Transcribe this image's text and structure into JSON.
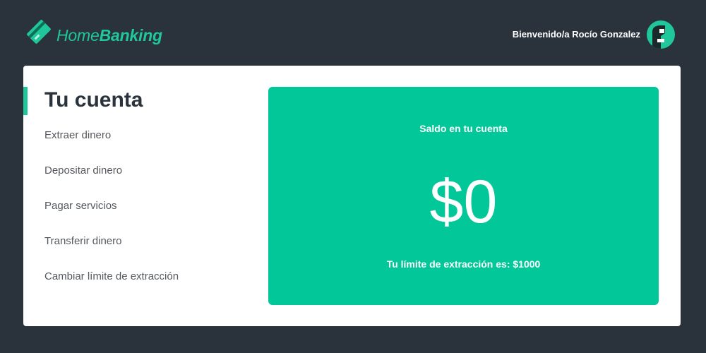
{
  "header": {
    "brand_light": "Home",
    "brand_bold": "Banking",
    "welcome": "Bienvenido/a Rocío Gonzalez"
  },
  "account": {
    "title": "Tu cuenta",
    "menu": [
      {
        "label": "Extraer dinero"
      },
      {
        "label": "Depositar dinero"
      },
      {
        "label": "Pagar servicios"
      },
      {
        "label": "Transferir dinero"
      },
      {
        "label": "Cambiar límite de extracción"
      }
    ]
  },
  "balance": {
    "label": "Saldo en tu cuenta",
    "amount": "$0",
    "limit_text": "Tu límite de extracción es: $1000"
  },
  "colors": {
    "background": "#2a323c",
    "accent": "#1fc79a",
    "panel": "#02c798",
    "card": "#ffffff"
  },
  "icons": {
    "logo": "card-logo-icon",
    "avatar": "user-avatar-icon"
  }
}
